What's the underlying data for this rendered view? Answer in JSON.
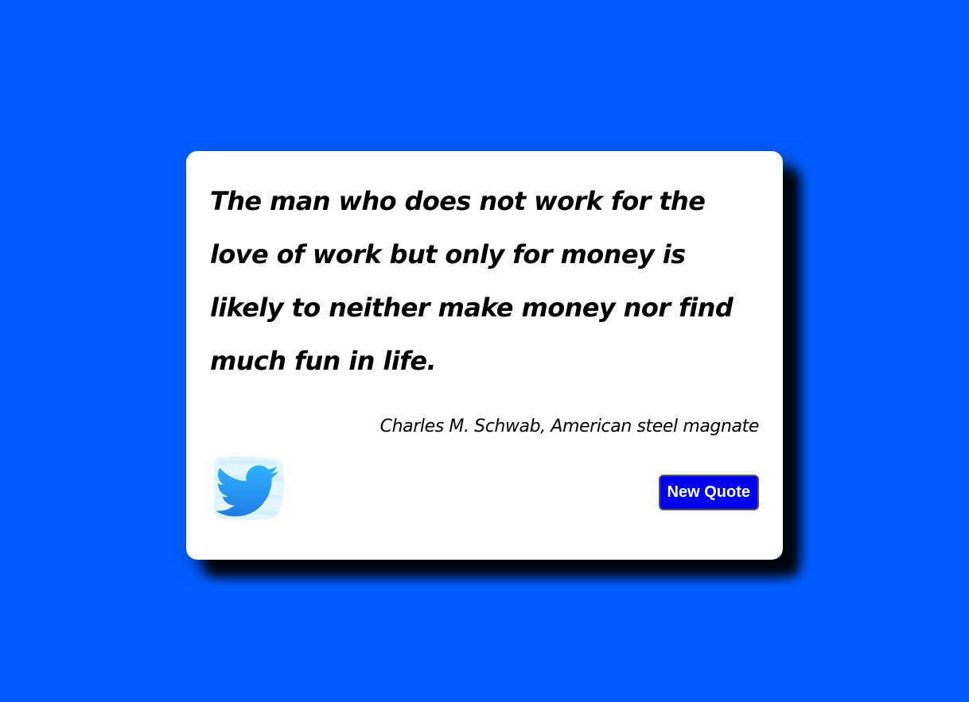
{
  "quote": {
    "text": "The man who does not work for the love of work but only for money is likely to neither make money nor find much fun in life.",
    "author": "Charles M. Schwab, American steel magnate"
  },
  "actions": {
    "tweet_icon": "twitter-bird-icon",
    "new_quote_label": "New Quote"
  },
  "colors": {
    "background": "#005cff",
    "card": "#ffffff",
    "button": "#0000ee",
    "twitter_blue": "#1da1f2"
  }
}
